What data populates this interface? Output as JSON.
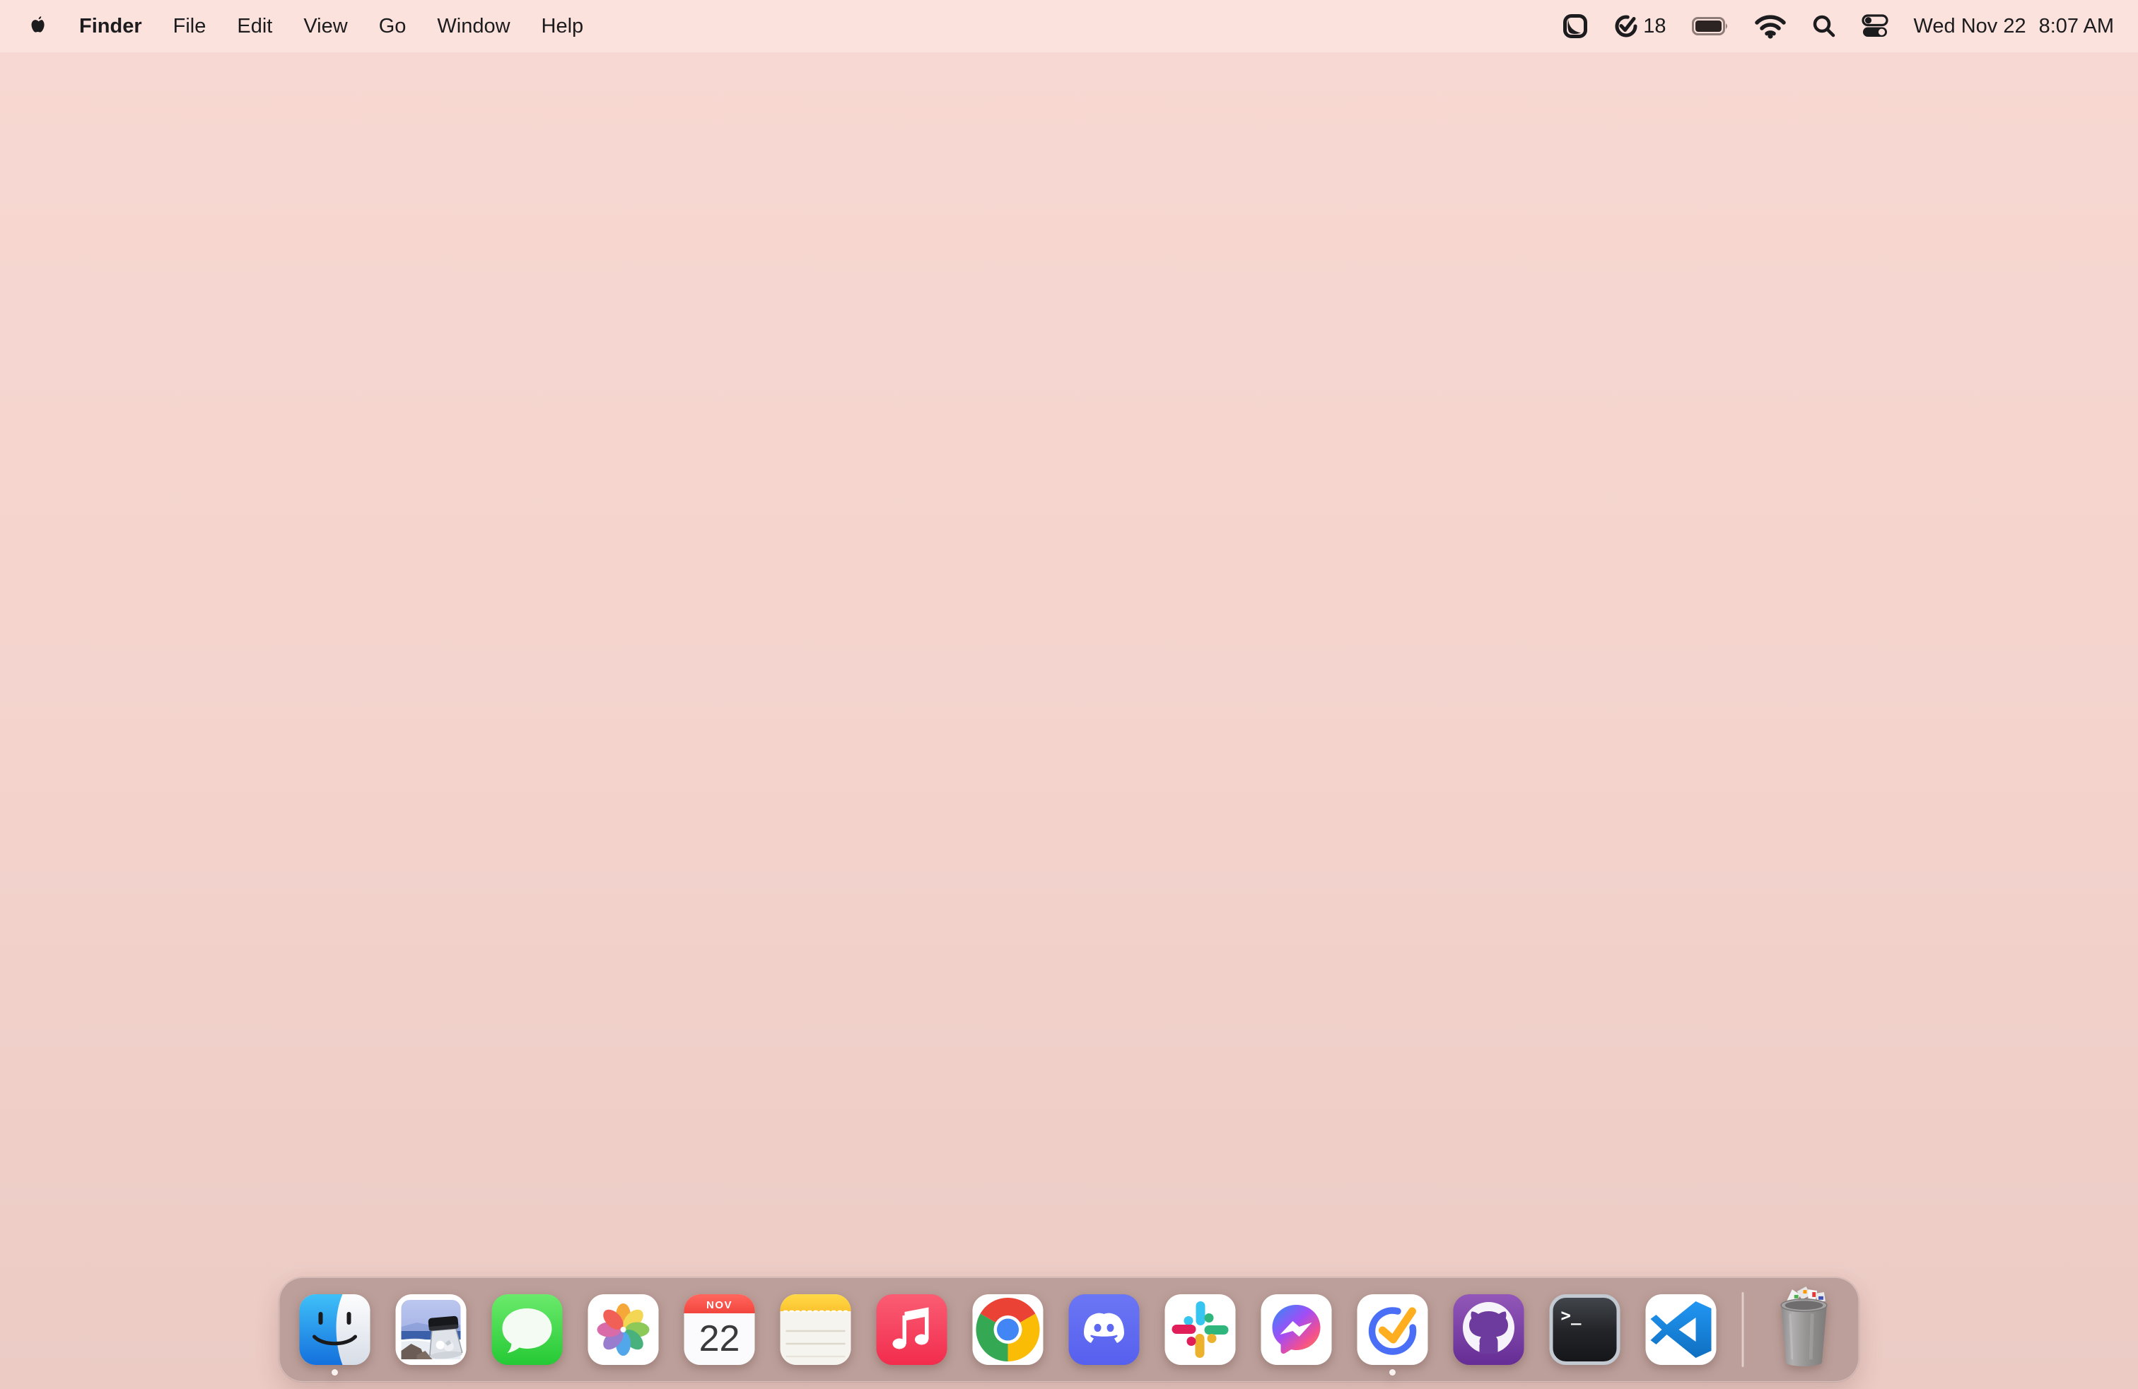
{
  "menubar": {
    "app_name": "Finder",
    "menus": [
      "File",
      "Edit",
      "View",
      "Go",
      "Window",
      "Help"
    ],
    "status": {
      "task_count": "18",
      "battery_level": "full",
      "date": "Wed Nov 22",
      "time": "8:07 AM"
    }
  },
  "dock": {
    "apps": [
      {
        "name": "Finder",
        "running": true
      },
      {
        "name": "Preview",
        "running": false
      },
      {
        "name": "Messages",
        "running": false
      },
      {
        "name": "Photos",
        "running": false
      },
      {
        "name": "Calendar",
        "running": false
      },
      {
        "name": "Notes",
        "running": false
      },
      {
        "name": "Music",
        "running": false
      },
      {
        "name": "Google Chrome",
        "running": false
      },
      {
        "name": "Discord",
        "running": false
      },
      {
        "name": "Slack",
        "running": false
      },
      {
        "name": "Messenger",
        "running": false
      },
      {
        "name": "TickTick",
        "running": true
      },
      {
        "name": "GitHub Desktop",
        "running": false
      },
      {
        "name": "Terminal",
        "running": false
      },
      {
        "name": "Visual Studio Code",
        "running": false
      },
      {
        "name": "Trash",
        "running": false
      }
    ],
    "calendar_icon": {
      "month": "NOV",
      "day": "22"
    },
    "terminal_icon": {
      "prompt": ">_"
    }
  },
  "colors": {
    "menubar_bg": "#fce2dd",
    "wallpaper_top": "#f8d8d2",
    "wallpaper_bottom": "#eccbc5",
    "dock_bg": "#b99c97",
    "ticktick_blue": "#4B6EF7",
    "ticktick_orange": "#FFAE1F",
    "discord_blurple": "#5E68F0",
    "github_purple": "#6D3B9E",
    "vscode_blue": "#0F80D7"
  }
}
